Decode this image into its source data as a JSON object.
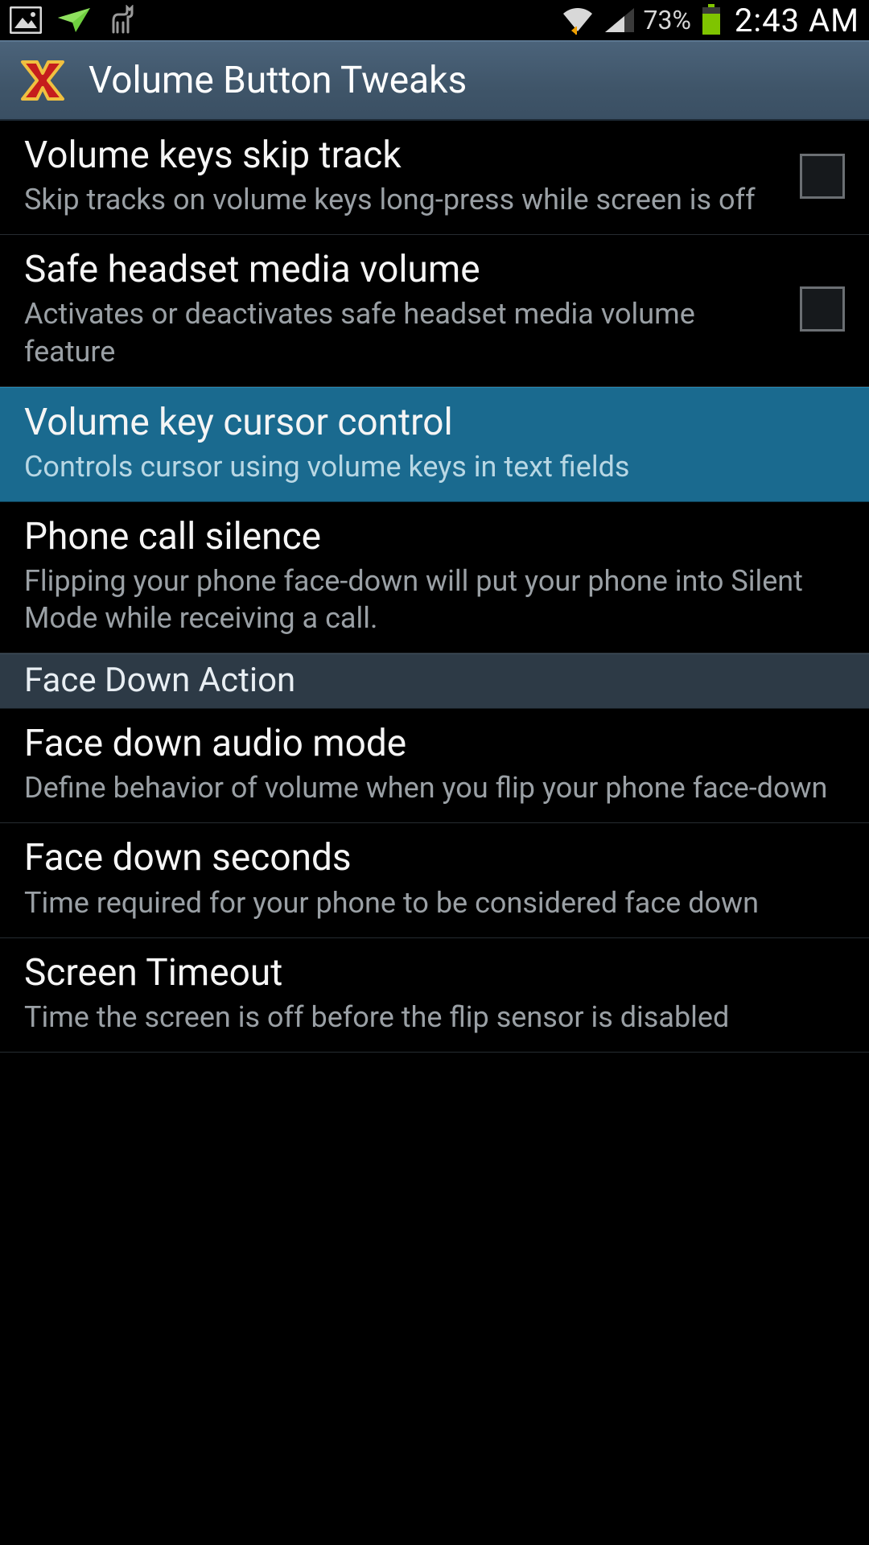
{
  "status": {
    "battery_pct": "73%",
    "clock": "2:43 AM"
  },
  "header": {
    "title": "Volume Button Tweaks"
  },
  "items": [
    {
      "title": "Volume keys skip track",
      "subtitle": "Skip tracks on volume keys long-press while screen is off",
      "checkbox": true,
      "checked": false
    },
    {
      "title": "Safe headset media volume",
      "subtitle": "Activates or deactivates safe headset media volume feature",
      "checkbox": true,
      "checked": false
    },
    {
      "title": "Volume key cursor control",
      "subtitle": "Controls cursor using volume keys in text fields",
      "highlight": true
    },
    {
      "title": "Phone call silence",
      "subtitle": "Flipping your phone face-down will put your phone into Silent Mode while receiving a call."
    }
  ],
  "section": {
    "title": "Face Down Action"
  },
  "items2": [
    {
      "title": "Face down audio mode",
      "subtitle": "Define behavior of volume when you flip your phone face-down"
    },
    {
      "title": "Face down seconds",
      "subtitle": "Time required for your phone to be considered face down"
    },
    {
      "title": "Screen Timeout",
      "subtitle": "Time the screen is off before the flip sensor is disabled"
    }
  ]
}
